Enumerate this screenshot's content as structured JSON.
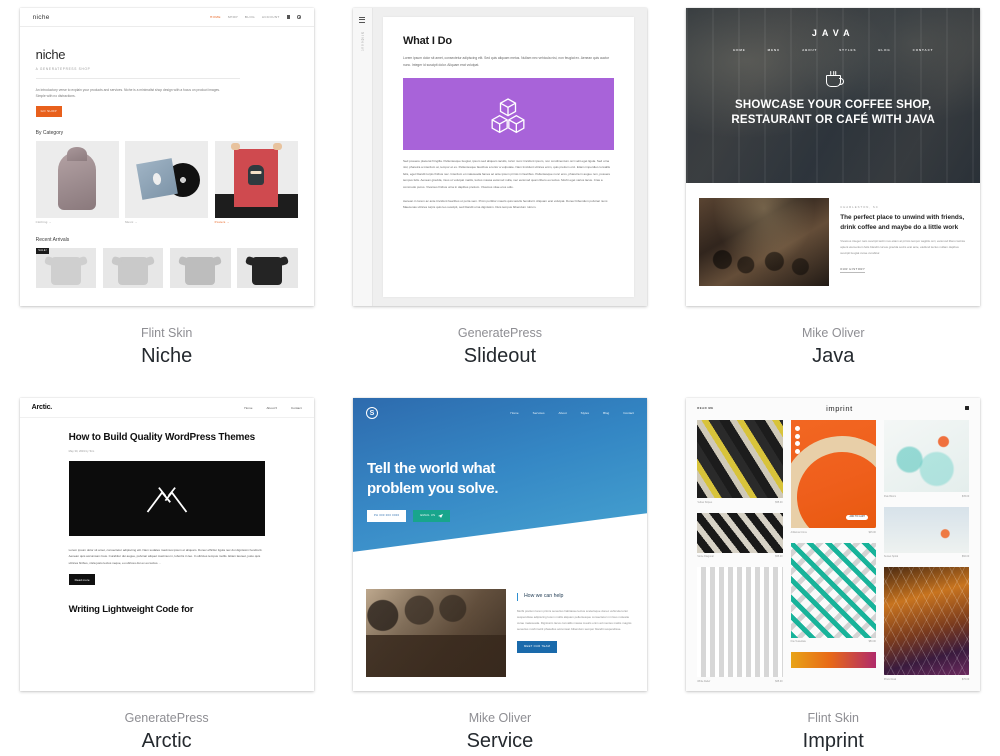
{
  "page": {
    "background": "#ffffff",
    "layout": "theme-gallery-grid-3x2"
  },
  "themes": [
    {
      "author": "Flint Skin",
      "name": "Niche",
      "preview": {
        "logo": "niche",
        "nav": [
          "HOME",
          "SHOP",
          "BLOG",
          "ACCOUNT"
        ],
        "nav_icons": [
          "cart-icon",
          "search-icon"
        ],
        "accent": "#e8601c",
        "heading": "niche",
        "subheading": "A GENERATEPRESS SHOP",
        "paragraph": "An introductory verse to explain your products and services. Niche is a minimalist shop design with a focus on product images. Simple with no distractions.",
        "button": "GO SHOP",
        "section_category": "By Category",
        "categories": [
          {
            "label": "Clothing →"
          },
          {
            "label": "Music →"
          },
          {
            "label": "Posters →"
          }
        ],
        "section_arrivals": "Recent Arrivals",
        "badge": "SALE!"
      }
    },
    {
      "author": "GeneratePress",
      "name": "Slideout",
      "preview": {
        "rail_label": "Slideout",
        "menu_icon": "hamburger-icon",
        "heading": "What I Do",
        "paragraph": "Lorem ipsum dolor sit amet, consectetur adipiscing elit. Sed quis aliquam metus. Nullam nec vehicula nisi, non feugiat ex. Aenean quis auctor nunc. Integer id suscipit dolor. Aliquam erat volutpat.",
        "feature_icon": "cubes-icon",
        "feature_color": "#a863d9",
        "body_1": "Sed posuere placerat fringilla. Pellentesque feugiat, ipsum sed aliquam iaculis, tortor nunc tincidunt ipsum, non condimentum orci velit eget ligula. Sed urna nisl, pharetra a interdum at, tempor et ex. Pellentesque faucibus a tortor a vulputate. Nam tincidunt ultrices enim, quis pretium orci. Etiam imperdiet convallis felis, eget blandit turpis finibus nec. Interdum et malesuada fames ac ante ipsum primis in faucibus. Pellentesque nunc eros, pharetra in augue non, posuere tempus felis. Aenean gravida, risus ut volutpat mattis, lectus massa euismod nulla, nec euismod quam libero eu lectus. Morbi eget varius lacus. Cras a commodo purus. Vivamus finibus urna in dapibus pretium. Vivamus vitae eros odio.",
        "body_2": "Aenean in lorem ac ante tincidunt faucibus ut porta sem. Proin porttitor mauris quis iaculis hendrerit. Aliquam erat volutpat. Donec bibendum pulvinar nunc. Maecenas ultrices turpis quis leo suscipit, sed blandit urna dignissim. Duis tempus bibendum rutrum."
      }
    },
    {
      "author": "Mike Oliver",
      "name": "Java",
      "preview": {
        "logo": "JAVA",
        "nav": [
          "HOME",
          "MENU",
          "ABOUT",
          "STYLES",
          "BLOG",
          "CONTACT"
        ],
        "hero_icon": "coffee-cup-icon",
        "hero_line_1": "SHOWCASE YOUR COFFEE SHOP,",
        "hero_line_2": "RESTAURANT OR CAFÉ WITH JAVA",
        "kicker": "CHARLESTON, SC",
        "heading": "The perfect place to unwind with friends, drink coffee and maybe do a little work",
        "paragraph": "Vivamus integer nam suscipit taciti mus etiam at primis tempor sagittis orci, euismod libero lacinia aptent elementum felis blandit cursus gravida sociis erat ante, eleifend lectus nullam dapibus suscipit feugiat curae curabitur.",
        "link": "OUR HISTORY"
      }
    },
    {
      "author": "GeneratePress",
      "name": "Arctic",
      "preview": {
        "logo": "Arctic.",
        "nav": [
          "Home",
          "About ▾",
          "Contact"
        ],
        "heading": "How to Build Quality WordPress Themes",
        "meta": "May 30, 2019 by Tom",
        "feature_icon": "crossed-tools-icon",
        "paragraph": "Lorem ipsum dolor sit amet, consectetur adipiscing elit. Nam sodales maximus ipsum et aliquam. Donec efficitur ligula nec dui dignissim hendrerit. Aenean quis accumsan risus. Curabitur dui augue, pulvinar aliquet maximus in, lobortis in leo. In ultricies tempus mollis. Etiam laoreet, justo quis ultrices finibus, nisla justo lectus neque, eu ultrices dui ex eu lectus. ..",
        "button": "Read more",
        "next_heading": "Writing Lightweight Code for"
      }
    },
    {
      "author": "Mike Oliver",
      "name": "Service",
      "preview": {
        "logo": "S",
        "nav": [
          "Home",
          "Services",
          "About",
          "Styles",
          "Blog",
          "Contact"
        ],
        "heading_line_1": "Tell the world what",
        "heading_line_2": "problem you solve.",
        "button_phone": "PH 000 000 0000",
        "button_email": "EMAIL US",
        "section_heading": "How we can help",
        "paragraph": "Morbi pretium lorem primis senectus habitasse lectus scelerisque donec vehicula tortor suspendisse adipiscing lorem mollis aliquam pellentesque consectetur mi risus molestie curae malesuada. Dignissim lacus convallis massa mauris enim ad mentes mattis magnis senectus morbi taciti phasellus accumsan bibendum semper blandit suspendisse.",
        "button_team": "MEET OUR TEAM",
        "accent": "#1a6aab"
      }
    },
    {
      "author": "Flint Skin",
      "name": "Imprint",
      "preview": {
        "read_me": "READ ME",
        "logo": "imprint",
        "cart_icon": "cart-icon",
        "products": [
          {
            "title": "Yellow Stripes",
            "price": "$55.00"
          },
          {
            "title": "Arillanna Citrus",
            "price": "$45.00"
          },
          {
            "title": "Pale Bloom",
            "price": "$35.00"
          },
          {
            "title": "Stone Diagonal",
            "price": "$55.00"
          },
          {
            "title": "Kite Tessellate",
            "price": "$50.00"
          },
          {
            "title": "Sunset Spiral",
            "price": "$60.00"
          },
          {
            "title": "White Relief",
            "price": "$65.00"
          },
          {
            "title": "Prism Dusk",
            "price": "$70.00"
          }
        ]
      }
    }
  ]
}
